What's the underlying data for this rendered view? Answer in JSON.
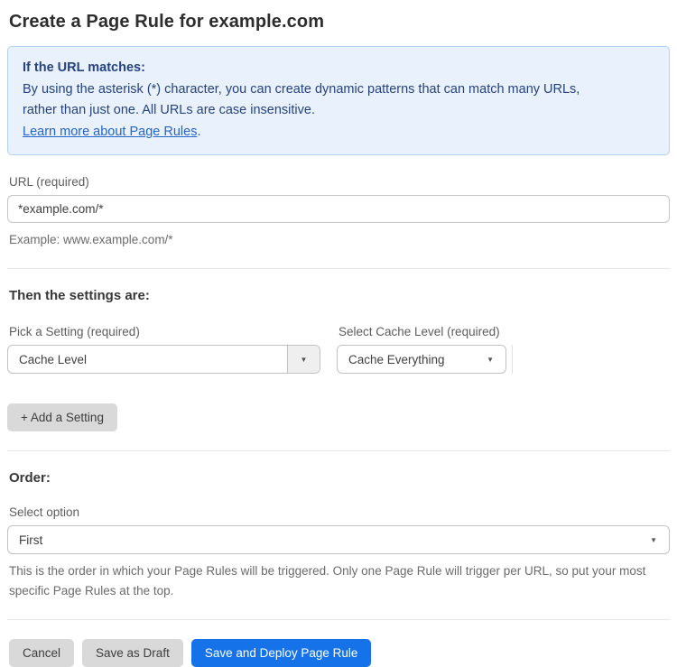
{
  "page": {
    "title": "Create a Page Rule for example.com"
  },
  "info_box": {
    "heading": "If the URL matches:",
    "body_line1": "By using the asterisk (*) character, you can create dynamic patterns that can match many URLs,",
    "body_line2": "rather than just one. All URLs are case insensitive.",
    "link_text": "Learn more about Page Rules",
    "link_suffix": "."
  },
  "url_field": {
    "label": "URL (required)",
    "value": "*example.com/*",
    "helper": "Example: www.example.com/*"
  },
  "settings": {
    "heading": "Then the settings are:",
    "setting_label": "Pick a Setting (required)",
    "setting_value": "Cache Level",
    "cache_label": "Select Cache Level (required)",
    "cache_value": "Cache Everything",
    "add_button_label": "+ Add a Setting"
  },
  "order": {
    "heading": "Order:",
    "label": "Select option",
    "value": "First",
    "helper": "This is the order in which your Page Rules will be triggered. Only one Page Rule will trigger per URL, so put your most specific Page Rules at the top."
  },
  "actions": {
    "cancel_label": "Cancel",
    "save_draft_label": "Save as Draft",
    "save_deploy_label": "Save and Deploy Page Rule"
  },
  "icons": {
    "dropdown_arrow": "▼"
  },
  "colors": {
    "info_bg": "#e9f2fc",
    "info_border": "#b3d2f2",
    "info_text": "#26427f",
    "link_blue": "#2365c8",
    "primary_button": "#1672e8",
    "gray_button": "#d9d9d9"
  }
}
